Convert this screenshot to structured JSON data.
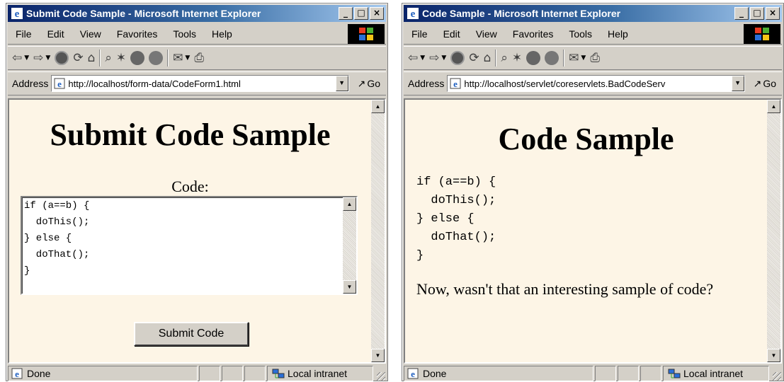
{
  "windows": {
    "left": {
      "title": "Submit Code Sample - Microsoft Internet Explorer",
      "address_label": "Address",
      "url": "http://localhost/form-data/CodeForm1.html",
      "go_label": "Go",
      "heading": "Submit Code Sample",
      "code_label": "Code:",
      "textarea_value": "if (a==b) {\n  doThis();\n} else {\n  doThat();\n}",
      "submit_label": "Submit Code",
      "status_text": "Done",
      "zone_text": "Local intranet"
    },
    "right": {
      "title": "Code Sample - Microsoft Internet Explorer",
      "address_label": "Address",
      "url": "http://localhost/servlet/coreservlets.BadCodeServ",
      "go_label": "Go",
      "heading": "Code Sample",
      "code": "if (a==b) {\n  doThis();\n} else {\n  doThat();\n}",
      "closing_text": "Now, wasn't that an interesting sample of code?",
      "status_text": "Done",
      "zone_text": "Local intranet"
    }
  },
  "menu": [
    "File",
    "Edit",
    "View",
    "Favorites",
    "Tools",
    "Help"
  ],
  "window_controls": [
    "_",
    "□",
    "×"
  ],
  "colors": {
    "title_bar_start": "#0a246a",
    "title_bar_end": "#a6caf0",
    "chrome": "#d4d0c8",
    "page_background": "#fdf5e6"
  },
  "toolbar_icons": [
    "back-icon",
    "forward-icon",
    "stop-icon",
    "refresh-icon",
    "home-icon",
    "search-icon",
    "favorites-icon",
    "media-icon",
    "history-icon",
    "mail-icon",
    "print-icon"
  ]
}
